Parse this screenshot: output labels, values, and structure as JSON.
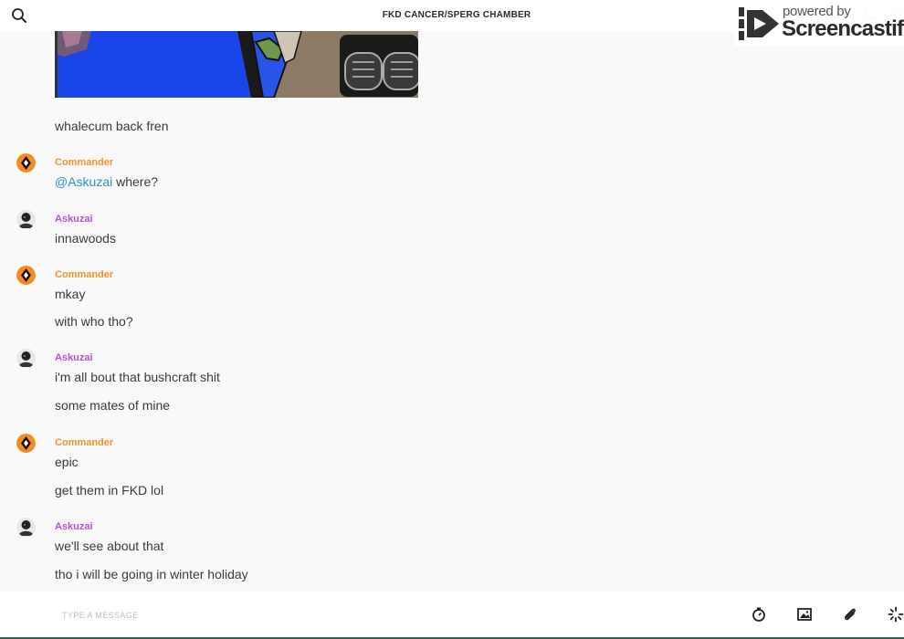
{
  "header": {
    "room_title": "FKD CANCER/SPERG CHAMBER",
    "search_icon": "search-icon",
    "phone_icon": "phone-icon",
    "info_icon": "info-icon"
  },
  "watermark": {
    "small": "powered by",
    "big": "Screencastify"
  },
  "messages": [
    {
      "type": "text",
      "text": "whalecum back fren"
    },
    {
      "author": "Commander",
      "mention": "@Askuzai",
      "text": " where?"
    },
    {
      "author": "Askuzai",
      "text": "innawoods"
    },
    {
      "author": "Commander",
      "text": "mkay"
    },
    {
      "type": "text",
      "text": "with who tho?"
    },
    {
      "author": "Askuzai",
      "text": "i'm all bout that bushcraft shit"
    },
    {
      "type": "text",
      "text": "some mates of mine"
    },
    {
      "author": "Commander",
      "text": "epic"
    },
    {
      "type": "text",
      "text": "get them in FKD lol"
    },
    {
      "author": "Askuzai",
      "text": "we'll see about that"
    },
    {
      "type": "text",
      "text": "tho i will be going in winter holiday"
    }
  ],
  "colors": {
    "commander": "#f2922c",
    "askuzai": "#b84fd6",
    "mention": "#2a8fd6"
  },
  "composer": {
    "placeholder": "TYPE A MESSAGE",
    "tools": [
      "timer-icon",
      "image-icon",
      "paperclip-icon",
      "sparkle-icon"
    ]
  }
}
